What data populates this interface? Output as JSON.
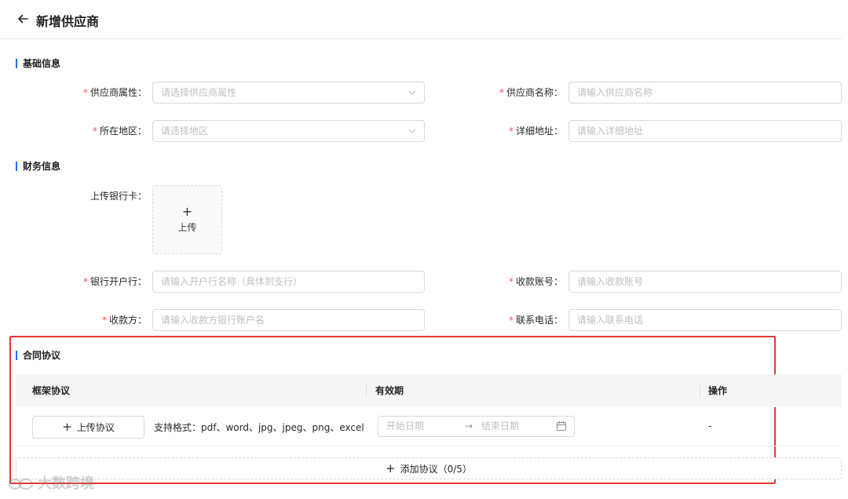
{
  "header": {
    "title": "新增供应商"
  },
  "basic": {
    "title": "基础信息",
    "supplier_attr": {
      "label": "供应商属性",
      "placeholder": "请选择供应商属性"
    },
    "supplier_name": {
      "label": "供应商名称",
      "placeholder": "请输入供应商名称"
    },
    "region": {
      "label": "所在地区",
      "placeholder": "请选择地区"
    },
    "address": {
      "label": "详细地址",
      "placeholder": "请输入详细地址"
    }
  },
  "finance": {
    "title": "财务信息",
    "bank_card": {
      "label": "上传银行卡",
      "upload_plus": "+",
      "upload_text": "上传"
    },
    "bank": {
      "label": "银行开户行",
      "placeholder": "请输入开户行名称（具体到支行）"
    },
    "account": {
      "label": "收款账号",
      "placeholder": "请输入收款账号"
    },
    "payee": {
      "label": "收款方",
      "placeholder": "请输入收款方银行账户名"
    },
    "phone": {
      "label": "联系电话",
      "placeholder": "请输入联系电话"
    }
  },
  "contract": {
    "title": "合同协议",
    "columns": [
      "框架协议",
      "有效期",
      "操作"
    ],
    "row": {
      "upload_label": "上传协议",
      "formats": "支持格式：pdf、word、jpg、jpeg、png、excel",
      "start_placeholder": "开始日期",
      "end_placeholder": "结束日期",
      "op": "-"
    },
    "add_label": "添加协议（0/5）"
  },
  "watermark": "大数跨境",
  "required_mark": "*",
  "colon": "：",
  "colors": {
    "accent": "#1a73e8",
    "required": "#ff4d4f",
    "highlight_box": "#e53935"
  }
}
